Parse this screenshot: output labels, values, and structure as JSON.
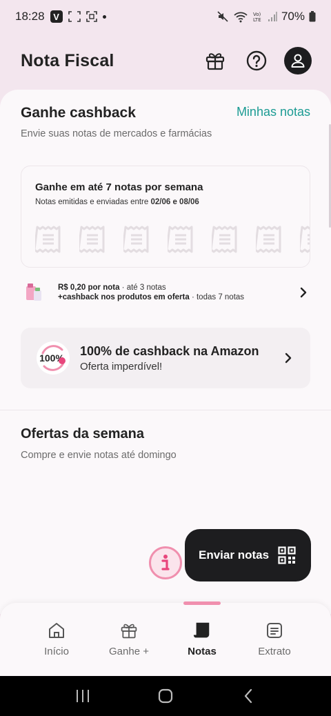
{
  "status_bar": {
    "time": "18:28",
    "battery": "70%",
    "icons": [
      "v-app-icon",
      "screenshot-icon",
      "scan-icon",
      "dot-icon",
      "mute-icon",
      "wifi-icon",
      "volte-icon",
      "signal-icon",
      "battery-icon"
    ]
  },
  "header": {
    "title": "Nota Fiscal",
    "actions": [
      "gift-icon",
      "help-icon",
      "profile-icon"
    ]
  },
  "cashback": {
    "title": "Ganhe cashback",
    "link": "Minhas notas",
    "subtitle": "Envie suas notas de mercados e farmácias"
  },
  "week_card": {
    "title": "Ganhe em até 7 notas por semana",
    "subtitle_prefix": "Notas emitidas e enviadas entre ",
    "date_range": "02/06 e 08/06",
    "receipts_shown": 7
  },
  "promo": {
    "line1_bold": "R$ 0,20 por nota",
    "line1_rest": " · até 3 notas",
    "line2_bold": "+cashback nos produtos em oferta",
    "line2_rest": " · todas 7 notas"
  },
  "amazon": {
    "badge": "100%",
    "title": "100% de cashback na Amazon",
    "subtitle": "Oferta imperdível!"
  },
  "offers": {
    "title": "Ofertas da semana",
    "subtitle": "Compre e envie notas até domingo"
  },
  "fab": {
    "send_label": "Enviar notas"
  },
  "bottom_nav": {
    "items": [
      {
        "label": "Início",
        "icon": "home-icon"
      },
      {
        "label": "Ganhe +",
        "icon": "gift-icon"
      },
      {
        "label": "Notas",
        "icon": "receipt-icon",
        "active": true
      },
      {
        "label": "Extrato",
        "icon": "statement-icon"
      }
    ]
  },
  "colors": {
    "accent_teal": "#1b9b93",
    "accent_pink": "#f08fae",
    "dark": "#1d1d1f"
  }
}
